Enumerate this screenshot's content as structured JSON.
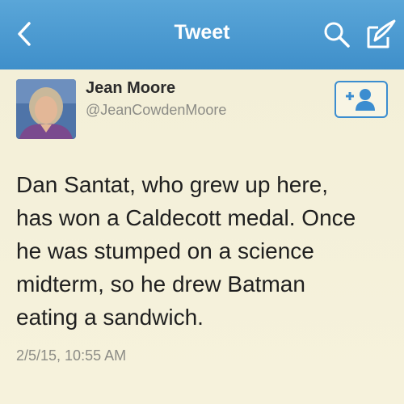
{
  "nav": {
    "title": "Tweet",
    "back_icon": "chevron-left-icon",
    "search_icon": "search-icon",
    "compose_icon": "compose-icon"
  },
  "tweet": {
    "author_name": "Jean Moore",
    "author_handle": "@JeanCowdenMoore",
    "follow_icon": "add-user-icon",
    "text_lines": [
      "Dan Santat, who grew up here,",
      "has won a Caldecott medal. Once",
      "he was stumped on a science",
      "midterm, so he drew Batman",
      "eating a sandwich."
    ],
    "timestamp": "2/5/15, 10:55 AM"
  },
  "colors": {
    "nav_bar": "#4a9ad2",
    "background": "#f4f0da",
    "follow_accent": "#3b8dd0"
  }
}
